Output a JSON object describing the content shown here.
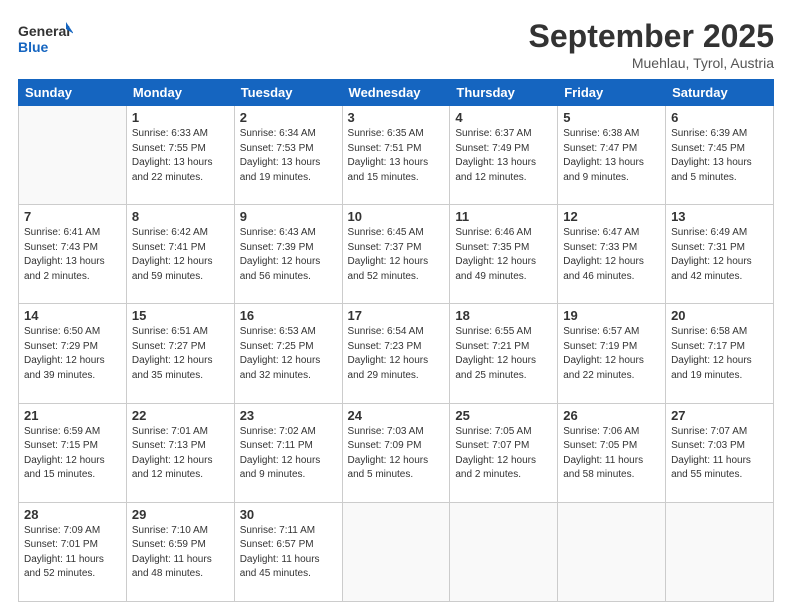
{
  "header": {
    "logo_text_general": "General",
    "logo_text_blue": "Blue",
    "month_year": "September 2025",
    "location": "Muehlau, Tyrol, Austria"
  },
  "columns": [
    "Sunday",
    "Monday",
    "Tuesday",
    "Wednesday",
    "Thursday",
    "Friday",
    "Saturday"
  ],
  "weeks": [
    [
      {
        "day": "",
        "info": ""
      },
      {
        "day": "1",
        "info": "Sunrise: 6:33 AM\nSunset: 7:55 PM\nDaylight: 13 hours\nand 22 minutes."
      },
      {
        "day": "2",
        "info": "Sunrise: 6:34 AM\nSunset: 7:53 PM\nDaylight: 13 hours\nand 19 minutes."
      },
      {
        "day": "3",
        "info": "Sunrise: 6:35 AM\nSunset: 7:51 PM\nDaylight: 13 hours\nand 15 minutes."
      },
      {
        "day": "4",
        "info": "Sunrise: 6:37 AM\nSunset: 7:49 PM\nDaylight: 13 hours\nand 12 minutes."
      },
      {
        "day": "5",
        "info": "Sunrise: 6:38 AM\nSunset: 7:47 PM\nDaylight: 13 hours\nand 9 minutes."
      },
      {
        "day": "6",
        "info": "Sunrise: 6:39 AM\nSunset: 7:45 PM\nDaylight: 13 hours\nand 5 minutes."
      }
    ],
    [
      {
        "day": "7",
        "info": "Sunrise: 6:41 AM\nSunset: 7:43 PM\nDaylight: 13 hours\nand 2 minutes."
      },
      {
        "day": "8",
        "info": "Sunrise: 6:42 AM\nSunset: 7:41 PM\nDaylight: 12 hours\nand 59 minutes."
      },
      {
        "day": "9",
        "info": "Sunrise: 6:43 AM\nSunset: 7:39 PM\nDaylight: 12 hours\nand 56 minutes."
      },
      {
        "day": "10",
        "info": "Sunrise: 6:45 AM\nSunset: 7:37 PM\nDaylight: 12 hours\nand 52 minutes."
      },
      {
        "day": "11",
        "info": "Sunrise: 6:46 AM\nSunset: 7:35 PM\nDaylight: 12 hours\nand 49 minutes."
      },
      {
        "day": "12",
        "info": "Sunrise: 6:47 AM\nSunset: 7:33 PM\nDaylight: 12 hours\nand 46 minutes."
      },
      {
        "day": "13",
        "info": "Sunrise: 6:49 AM\nSunset: 7:31 PM\nDaylight: 12 hours\nand 42 minutes."
      }
    ],
    [
      {
        "day": "14",
        "info": "Sunrise: 6:50 AM\nSunset: 7:29 PM\nDaylight: 12 hours\nand 39 minutes."
      },
      {
        "day": "15",
        "info": "Sunrise: 6:51 AM\nSunset: 7:27 PM\nDaylight: 12 hours\nand 35 minutes."
      },
      {
        "day": "16",
        "info": "Sunrise: 6:53 AM\nSunset: 7:25 PM\nDaylight: 12 hours\nand 32 minutes."
      },
      {
        "day": "17",
        "info": "Sunrise: 6:54 AM\nSunset: 7:23 PM\nDaylight: 12 hours\nand 29 minutes."
      },
      {
        "day": "18",
        "info": "Sunrise: 6:55 AM\nSunset: 7:21 PM\nDaylight: 12 hours\nand 25 minutes."
      },
      {
        "day": "19",
        "info": "Sunrise: 6:57 AM\nSunset: 7:19 PM\nDaylight: 12 hours\nand 22 minutes."
      },
      {
        "day": "20",
        "info": "Sunrise: 6:58 AM\nSunset: 7:17 PM\nDaylight: 12 hours\nand 19 minutes."
      }
    ],
    [
      {
        "day": "21",
        "info": "Sunrise: 6:59 AM\nSunset: 7:15 PM\nDaylight: 12 hours\nand 15 minutes."
      },
      {
        "day": "22",
        "info": "Sunrise: 7:01 AM\nSunset: 7:13 PM\nDaylight: 12 hours\nand 12 minutes."
      },
      {
        "day": "23",
        "info": "Sunrise: 7:02 AM\nSunset: 7:11 PM\nDaylight: 12 hours\nand 9 minutes."
      },
      {
        "day": "24",
        "info": "Sunrise: 7:03 AM\nSunset: 7:09 PM\nDaylight: 12 hours\nand 5 minutes."
      },
      {
        "day": "25",
        "info": "Sunrise: 7:05 AM\nSunset: 7:07 PM\nDaylight: 12 hours\nand 2 minutes."
      },
      {
        "day": "26",
        "info": "Sunrise: 7:06 AM\nSunset: 7:05 PM\nDaylight: 11 hours\nand 58 minutes."
      },
      {
        "day": "27",
        "info": "Sunrise: 7:07 AM\nSunset: 7:03 PM\nDaylight: 11 hours\nand 55 minutes."
      }
    ],
    [
      {
        "day": "28",
        "info": "Sunrise: 7:09 AM\nSunset: 7:01 PM\nDaylight: 11 hours\nand 52 minutes."
      },
      {
        "day": "29",
        "info": "Sunrise: 7:10 AM\nSunset: 6:59 PM\nDaylight: 11 hours\nand 48 minutes."
      },
      {
        "day": "30",
        "info": "Sunrise: 7:11 AM\nSunset: 6:57 PM\nDaylight: 11 hours\nand 45 minutes."
      },
      {
        "day": "",
        "info": ""
      },
      {
        "day": "",
        "info": ""
      },
      {
        "day": "",
        "info": ""
      },
      {
        "day": "",
        "info": ""
      }
    ]
  ]
}
